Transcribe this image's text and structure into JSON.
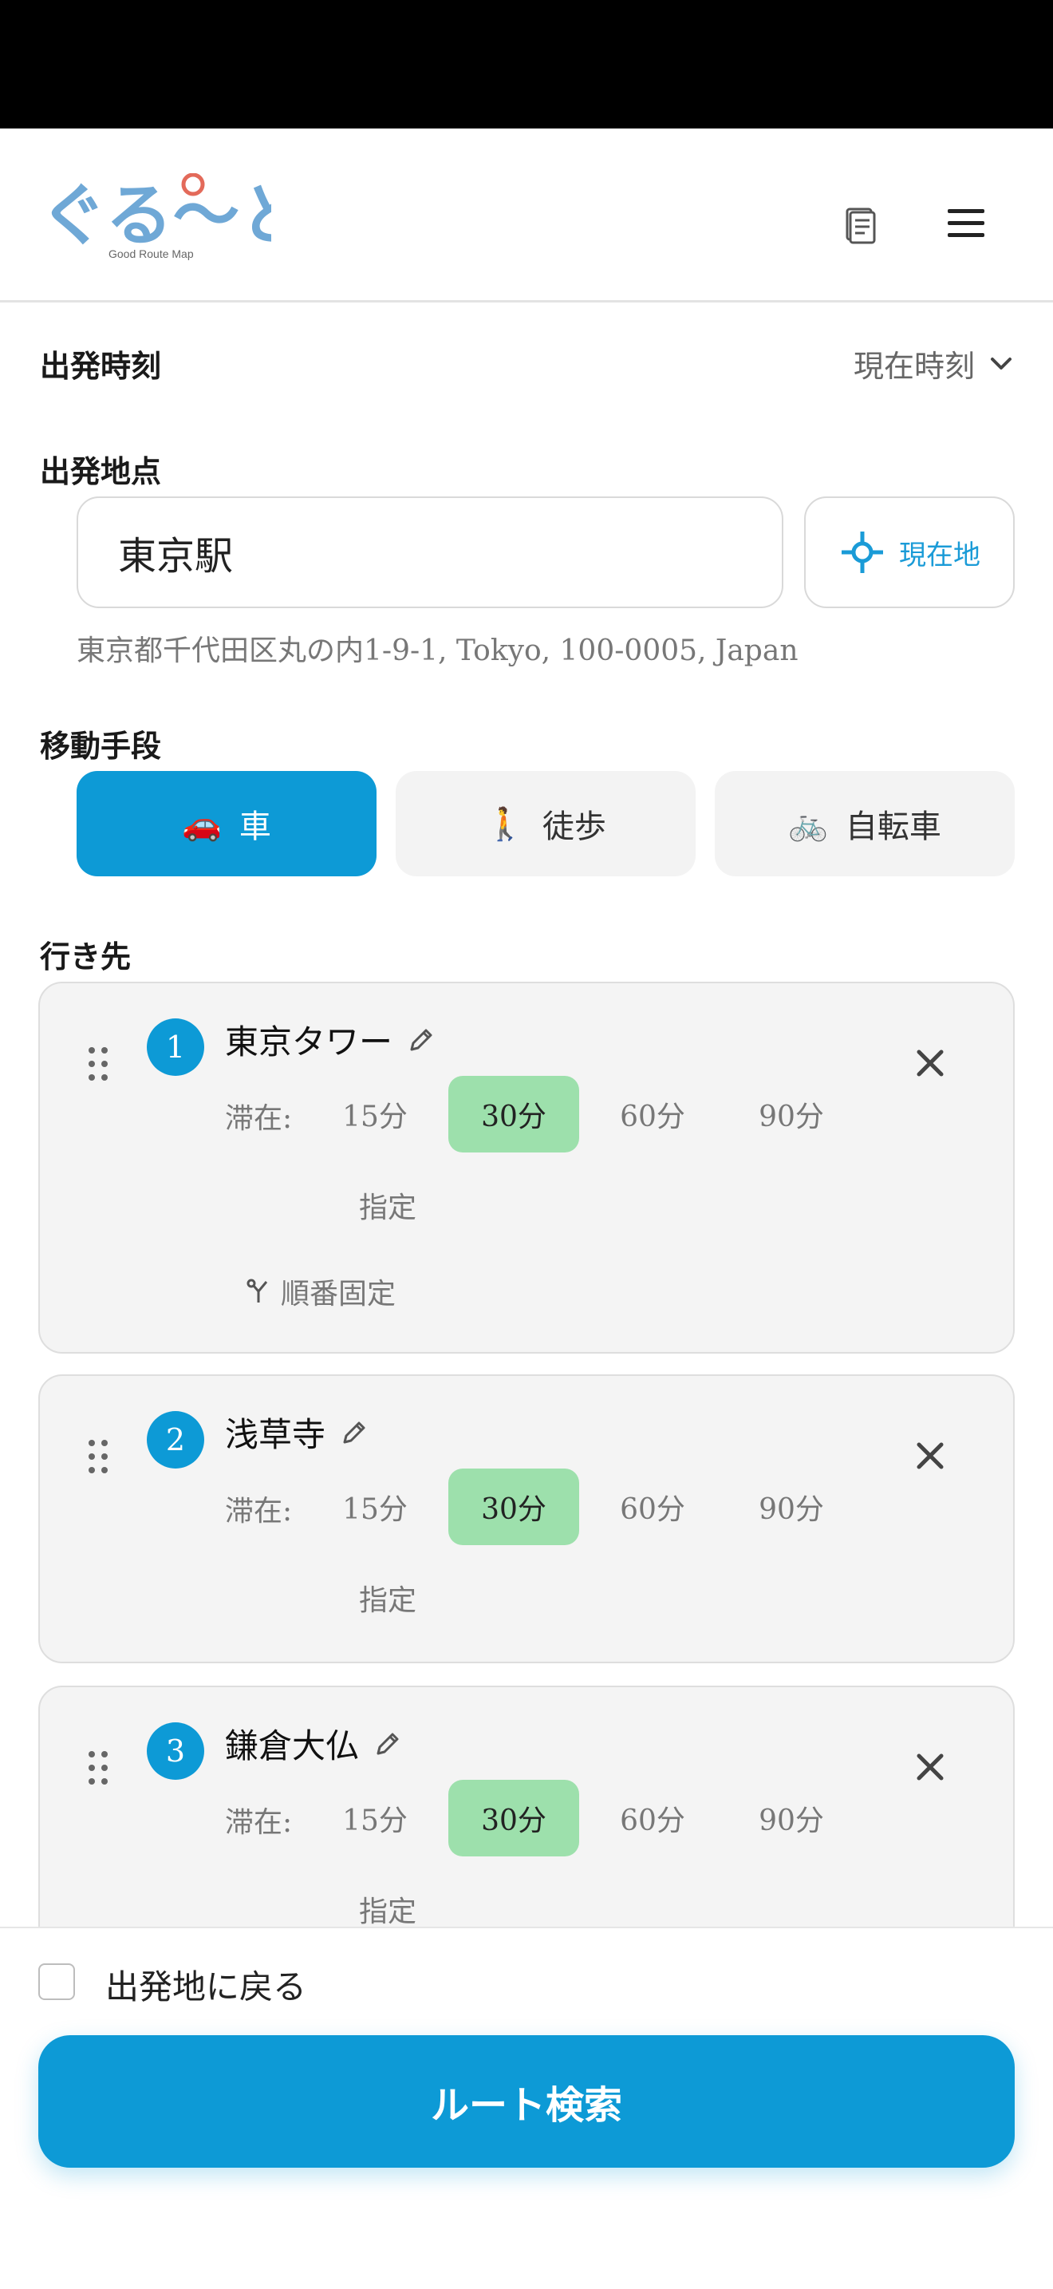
{
  "app": {
    "logo_text": "ぐる〜と",
    "logo_subtitle": "Good Route Map"
  },
  "departure_time": {
    "label": "出発時刻",
    "value": "現在時刻"
  },
  "origin": {
    "label": "出発地点",
    "value": "東京駅",
    "current_location_label": "現在地",
    "address": "東京都千代田区丸の内1-9-1, Tokyo, 100-0005, Japan"
  },
  "transport": {
    "label": "移動手段",
    "modes": [
      {
        "icon": "🚗",
        "label": "車",
        "active": true
      },
      {
        "icon": "🚶",
        "label": "徒歩",
        "active": false
      },
      {
        "icon": "🚲",
        "label": "自転車",
        "active": false
      }
    ]
  },
  "destinations": {
    "label": "行き先",
    "stay_label": "滞在:",
    "options": [
      "15分",
      "30分",
      "60分",
      "90分"
    ],
    "custom_label": "指定",
    "lock_order_label": "順番固定",
    "items": [
      {
        "number": "1",
        "name": "東京タワー",
        "selected": "30分"
      },
      {
        "number": "2",
        "name": "浅草寺",
        "selected": "30分"
      },
      {
        "number": "3",
        "name": "鎌倉大仏",
        "selected": "30分"
      }
    ]
  },
  "bottom": {
    "return_label": "出発地に戻る",
    "search_label": "ルート検索"
  },
  "colors": {
    "primary": "#0d9ad6",
    "selected_stay": "#9de0ac",
    "card_bg": "#f4f4f4"
  }
}
